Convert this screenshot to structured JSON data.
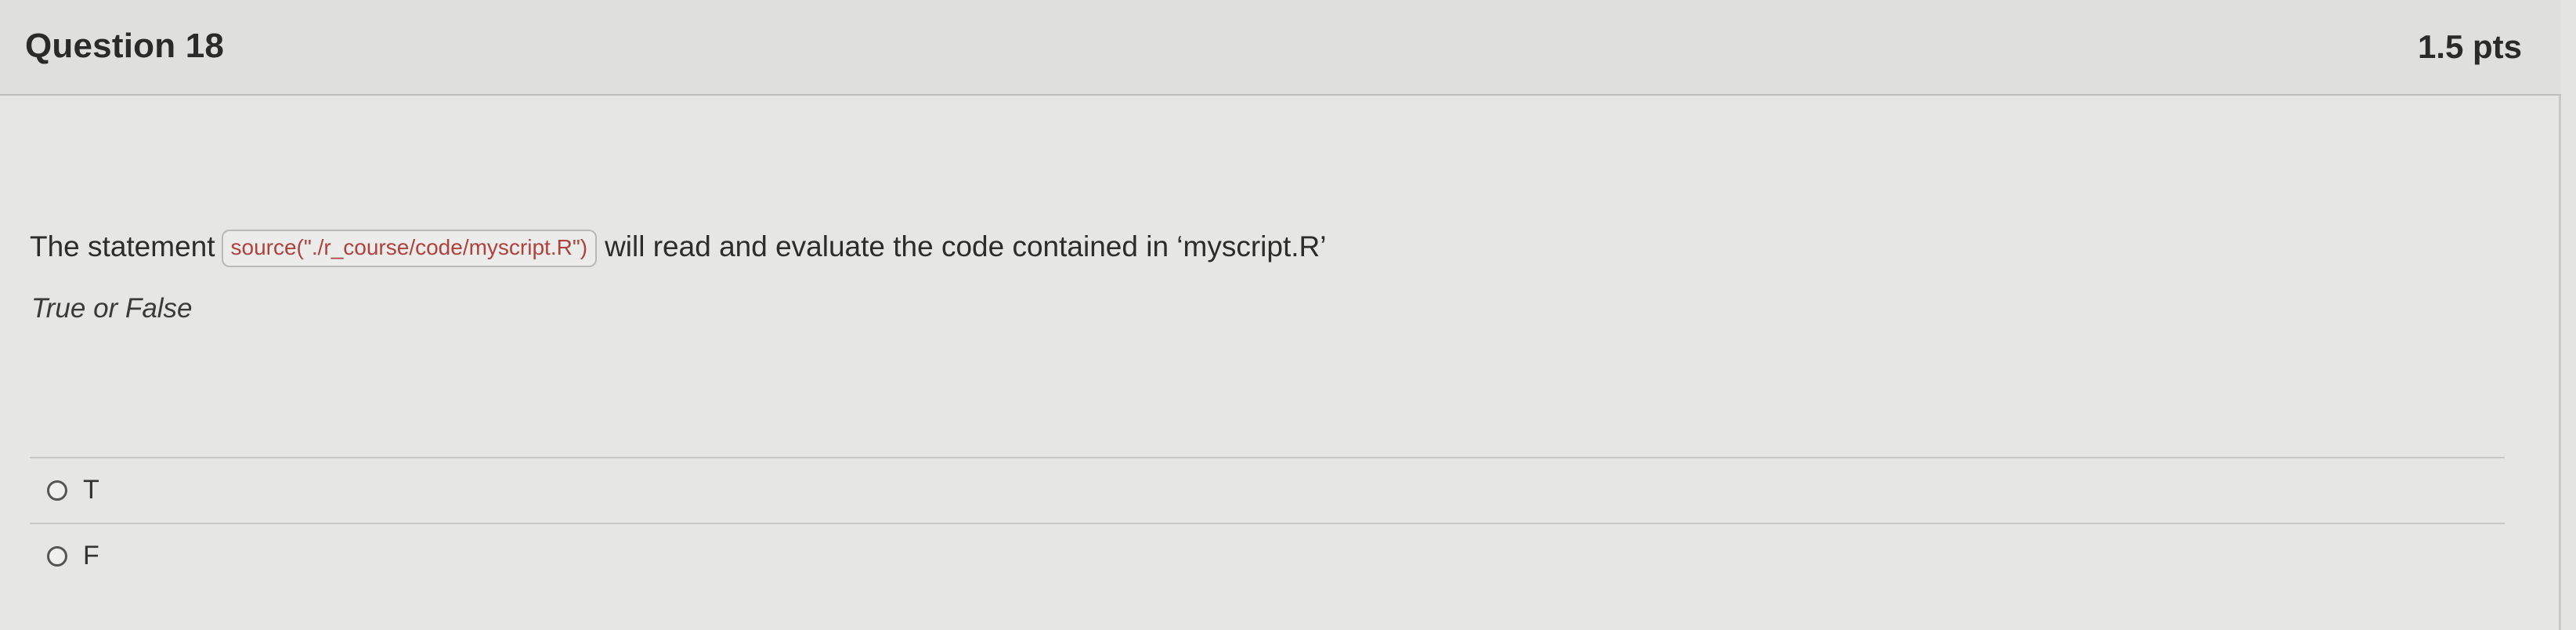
{
  "question": {
    "title": "Question 18",
    "points": "1.5 pts",
    "text_before": "The statement",
    "code": "source(\"./r_course/code/myscript.R\")",
    "text_after": "will read and evaluate the code contained in ‘myscript.R’",
    "hint": "True or False"
  },
  "answers": [
    {
      "label": "T",
      "selected": false
    },
    {
      "label": "F",
      "selected": false
    }
  ]
}
